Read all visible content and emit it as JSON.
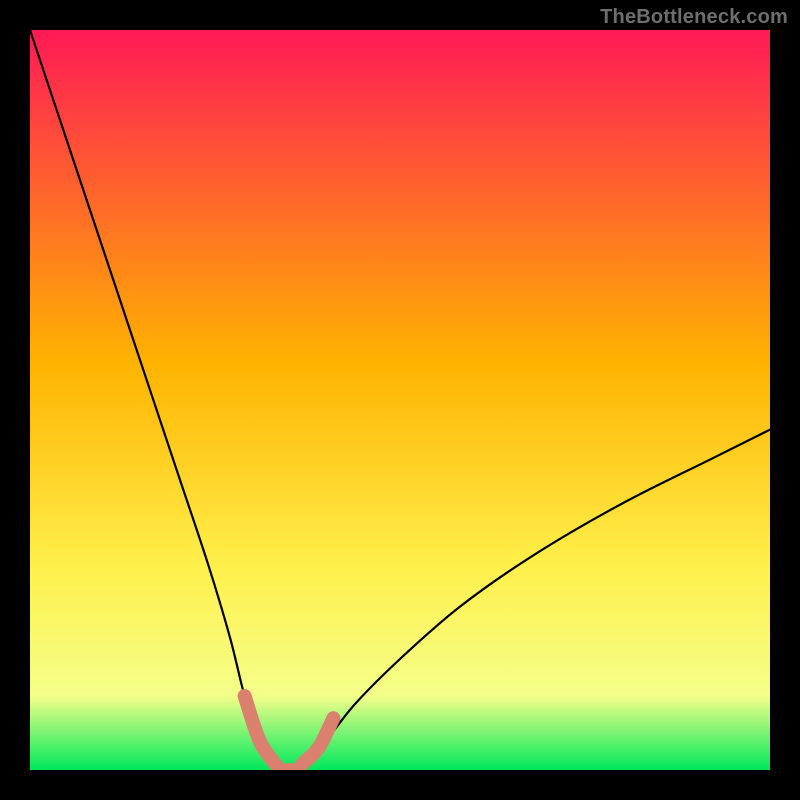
{
  "watermark": "TheBottleneck.com",
  "chart_data": {
    "type": "line",
    "title": "",
    "xlabel": "",
    "ylabel": "",
    "xlim": [
      0,
      100
    ],
    "ylim": [
      0,
      100
    ],
    "grid": false,
    "legend": false,
    "background_gradient": {
      "stops": [
        {
          "offset": 0.0,
          "color": "#ff1a56"
        },
        {
          "offset": 0.45,
          "color": "#ffb300"
        },
        {
          "offset": 0.72,
          "color": "#ffef4a"
        },
        {
          "offset": 0.9,
          "color": "#f4ff8a"
        },
        {
          "offset": 1.0,
          "color": "#00e85c"
        }
      ]
    },
    "series": [
      {
        "name": "bottleneck-curve",
        "color": "#000000",
        "x": [
          0,
          4,
          8,
          12,
          16,
          20,
          24,
          27,
          29,
          31,
          33,
          35,
          37,
          40,
          44,
          50,
          58,
          68,
          80,
          92,
          100
        ],
        "y": [
          100,
          88,
          76,
          64,
          52,
          40,
          28,
          18,
          10,
          4,
          1,
          0,
          1,
          4,
          9,
          15,
          22,
          29,
          36,
          42,
          46
        ]
      },
      {
        "name": "highlight-band",
        "color": "#d9806f",
        "stroke_width": 14,
        "x": [
          29,
          31,
          33,
          34,
          35,
          36,
          37,
          39,
          41
        ],
        "y": [
          10,
          4,
          1,
          0,
          0,
          0,
          1,
          3,
          7
        ]
      }
    ],
    "annotations": []
  }
}
